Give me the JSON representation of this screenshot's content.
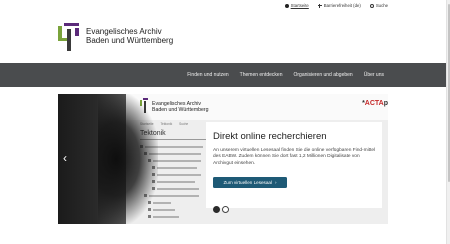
{
  "utility": {
    "items": [
      {
        "label": "Startseite",
        "icon": "dot-icon",
        "active": true
      },
      {
        "label": "Barrierefreiheit (de)",
        "icon": "wheelchair-icon",
        "active": false
      },
      {
        "label": "Suche",
        "icon": "search-icon",
        "active": false
      }
    ]
  },
  "logo": {
    "line1": "Evangelisches Archiv",
    "line2": "Baden und Württemberg"
  },
  "nav": {
    "items": [
      "Finden und nutzen",
      "Themen entdecken",
      "Organisieren und abgeben",
      "Über uns"
    ]
  },
  "hero": {
    "screen": {
      "logo_line1": "Evangelisches Archiv",
      "logo_line2": "Baden und Württemberg",
      "brand_prefix": "ACTA",
      "brand_suffix": "p",
      "tabs": [
        "Startseite",
        "Tektonik",
        "Suche"
      ],
      "title": "Tektonik"
    },
    "card": {
      "title": "Direkt online recherchieren",
      "body": "An unserem virtuellen Lesesaal finden Sie die online verfügbaren Find-mittel des EABW. Zudem können Sie dort fast 1,2 Millionen Digitalisate von Archivgut einsehen.",
      "button": "Zum virtuellen Lesesaal",
      "button_arrow": "›"
    },
    "prev": "‹",
    "next": "›",
    "slides": 2,
    "active_slide": 1
  },
  "colors": {
    "nav_bg": "#4a4c4e",
    "button_bg": "#1e5a76",
    "logo_green": "#7aa33b",
    "logo_purple": "#5b2a7a"
  }
}
